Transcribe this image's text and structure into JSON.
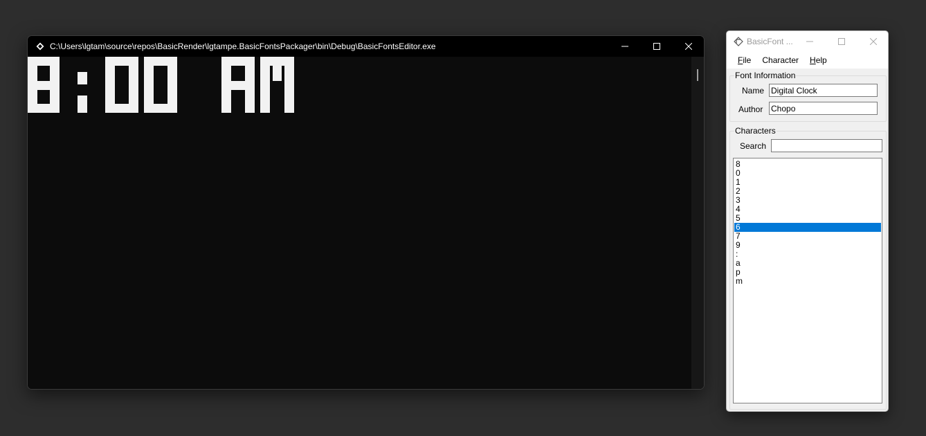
{
  "console": {
    "title": "C:\\Users\\lgtam\\source\\repos\\BasicRender\\lgtampe.BasicFontsPackager\\bin\\Debug\\BasicFontsEditor.exe",
    "pixel_text": "8:00 AM",
    "icons": {
      "app": "console-app-icon",
      "minimize": "minimize-icon",
      "maximize": "maximize-icon",
      "close": "close-icon"
    }
  },
  "editor": {
    "title": "BasicFont ...",
    "menu": [
      {
        "label": "File",
        "mnemonic": "F"
      },
      {
        "label": "Character",
        "mnemonic": ""
      },
      {
        "label": "Help",
        "mnemonic": "H"
      }
    ],
    "font_information": {
      "legend": "Font Information",
      "name_label": "Name",
      "name_value": "Digital Clock",
      "author_label": "Author",
      "author_value": "Chopo"
    },
    "characters": {
      "legend": "Characters",
      "search_label": "Search",
      "search_value": "",
      "items": [
        "8",
        "0",
        "1",
        "2",
        "3",
        "4",
        "5",
        "6",
        "7",
        "9",
        ":",
        "a",
        "p",
        "m"
      ],
      "selected": "6"
    },
    "selection_color": "#0078d7"
  }
}
